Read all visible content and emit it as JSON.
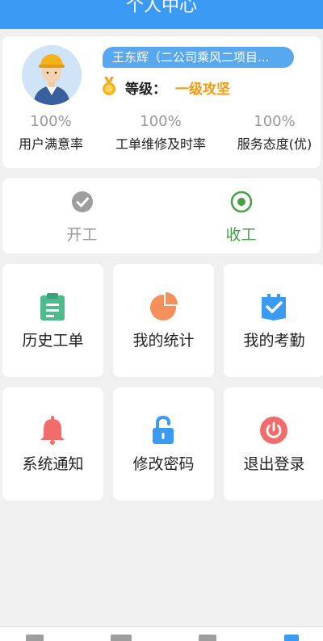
{
  "header": {
    "title": "个人中心"
  },
  "profile": {
    "name": "王东辉（二公司乘风二项目...",
    "level_label": "等级：",
    "level_value": "一级攻坚",
    "stats": [
      {
        "value": "100%",
        "label": "用户满意率"
      },
      {
        "value": "100%",
        "label": "工单维修及时率"
      },
      {
        "value": "100%",
        "label": "服务态度(优)"
      }
    ]
  },
  "work": {
    "start_label": "开工",
    "end_label": "收工"
  },
  "tiles": [
    {
      "label": "历史工单",
      "icon": "clipboard-icon",
      "color": "#4dbb8c"
    },
    {
      "label": "我的统计",
      "icon": "pie-chart-icon",
      "color": "#f5905a"
    },
    {
      "label": "我的考勤",
      "icon": "calendar-check-icon",
      "color": "#3b9af3"
    },
    {
      "label": "系统通知",
      "icon": "bell-icon",
      "color": "#f26c6c"
    },
    {
      "label": "修改密码",
      "icon": "unlock-icon",
      "color": "#3b9af3"
    },
    {
      "label": "退出登录",
      "icon": "power-icon",
      "color": "#f26c6c"
    }
  ],
  "colors": {
    "header": "#3b9af3",
    "accent_orange": "#f59a10",
    "green": "#43a047"
  }
}
